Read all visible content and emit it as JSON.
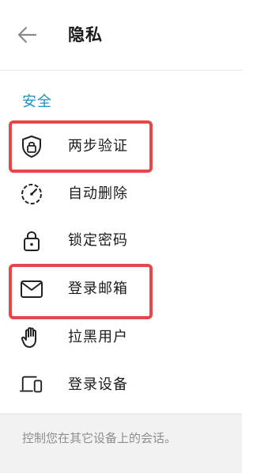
{
  "header": {
    "back_icon": "arrow-left-icon",
    "title": "隐私"
  },
  "security": {
    "section_title": "安全",
    "items": [
      {
        "label": "两步验证",
        "icon": "shield-lock-icon",
        "highlighted": true
      },
      {
        "label": "自动删除",
        "icon": "timer-icon",
        "highlighted": false
      },
      {
        "label": "锁定密码",
        "icon": "lock-icon",
        "highlighted": false
      },
      {
        "label": "登录邮箱",
        "icon": "mail-icon",
        "highlighted": true
      },
      {
        "label": "拉黑用户",
        "icon": "hand-icon",
        "highlighted": false
      },
      {
        "label": "登录设备",
        "icon": "devices-icon",
        "highlighted": false
      }
    ]
  },
  "footer": {
    "text": "控制您在其它设备上的会话。"
  },
  "colors": {
    "accent": "#1e8fc6",
    "highlight": "#e84747",
    "text": "#1b1b1b",
    "muted": "#8e8e8e"
  }
}
